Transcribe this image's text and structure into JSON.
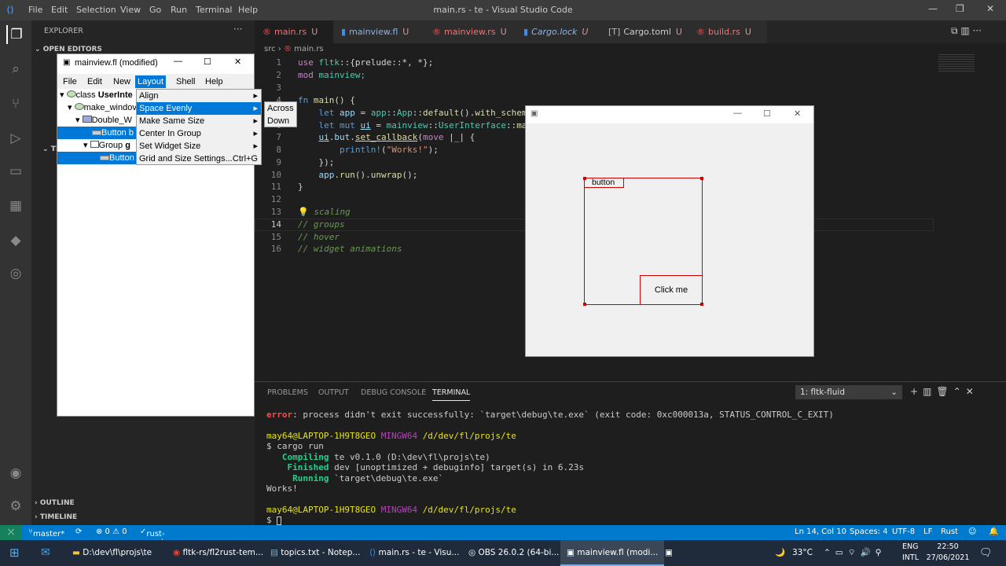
{
  "vscode": {
    "menu": [
      "File",
      "Edit",
      "Selection",
      "View",
      "Go",
      "Run",
      "Terminal",
      "Help"
    ],
    "title": "main.rs - te - Visual Studio Code"
  },
  "sidebar": {
    "explorer": "EXPLORER",
    "open_editors": "OPEN EDITORS",
    "te": "TE",
    "outline": "OUTLINE",
    "timeline": "TIMELINE"
  },
  "tabs": [
    {
      "label": "main.rs",
      "status": "U"
    },
    {
      "label": "mainview.fl",
      "status": "U"
    },
    {
      "label": "mainview.rs",
      "status": "U"
    },
    {
      "label": "Cargo.lock",
      "status": "U"
    },
    {
      "label": "Cargo.toml",
      "status": "U"
    },
    {
      "label": "build.rs",
      "status": "U"
    }
  ],
  "breadcrumb": {
    "folder": "src",
    "file": "main.rs"
  },
  "code": {
    "lines": [
      "1",
      "2",
      "3",
      "4",
      "5",
      "6",
      "7",
      "8",
      "9",
      "10",
      "11",
      "12",
      "13",
      "14",
      "15",
      "16"
    ],
    "l1a": "use ",
    "l1b": "fltk",
    "l1c": "::{prelude::*, *};",
    "l2a": "mod ",
    "l2b": "mainview;",
    "l4a": "fn ",
    "l4b": "main",
    "l4c": "() {",
    "l5a": "    let ",
    "l5b": "app",
    "l5c": " = ",
    "l5d": "app",
    "l5e": "::",
    "l5f": "App",
    "l5g": "::",
    "l5h": "default",
    "l5i": "().",
    "l5j": "with_scheme",
    "l6a": "    let mut ",
    "l6b": "ui",
    "l6c": " = ",
    "l6d": "mainview",
    "l6e": "::",
    "l6f": "UserInterface",
    "l6g": "::",
    "l6h": "make",
    "l7a": "    ",
    "l7b": "ui",
    "l7c": ".",
    "l7d": "but",
    "l7e": ".",
    "l7f": "set_callback",
    "l7g": "(",
    "l7h": "move",
    "l7i": " |_| {",
    "l8a": "        ",
    "l8b": "println!",
    "l8c": "(",
    "l8d": "\"Works!\"",
    "l8e": ");",
    "l9": "    });",
    "l10a": "    ",
    "l10b": "app",
    "l10c": ".",
    "l10d": "run",
    "l10e": "().",
    "l10f": "unwrap",
    "l10g": "();",
    "l11": "}",
    "l13": "scaling",
    "l14": "// groups",
    "l15": "// hover",
    "l16": "// widget animations"
  },
  "panel": {
    "tabs": [
      "PROBLEMS",
      "OUTPUT",
      "DEBUG CONSOLE",
      "TERMINAL"
    ],
    "terminal_select": "1: fltk-fluid",
    "lines": {
      "err_a": "error",
      "err_b": ": process didn't exit successfully: `target\\debug\\te.exe` (exit code: 0xc000013a, STATUS_CONTROL_C_EXIT)",
      "p1_user": "may64@LAPTOP-1H9T8GEO",
      "p1_env": "MINGW64",
      "p1_path": "/d/dev/fl/projs/te",
      "cmd": "$ cargo run",
      "c1a": "   Compiling",
      "c1b": " te v0.1.0 (D:\\dev\\fl\\projs\\te)",
      "c2a": "    Finished",
      "c2b": " dev [unoptimized + debuginfo] target(s) in 6.23s",
      "c3a": "     Running",
      "c3b": " `target\\debug\\te.exe`",
      "works": "Works!",
      "p2_user": "may64@LAPTOP-1H9T8GEO",
      "p2_env": "MINGW64",
      "p2_path": "/d/dev/fl/projs/te",
      "prompt": "$ "
    }
  },
  "status": {
    "branch": "master*",
    "errors": "⊗ 0 ⚠ 0",
    "rust": "rust-analyzer",
    "pos": "Ln 14, Col 10",
    "spaces": "Spaces: 4",
    "enc": "UTF-8",
    "eol": "LF",
    "lang": "Rust"
  },
  "fluid": {
    "title": "mainview.fl (modified)",
    "menu": [
      "File",
      "Edit",
      "New",
      "Layout",
      "Shell",
      "Help"
    ],
    "tree": [
      {
        "label": "class",
        "bold": "UserInte"
      },
      {
        "label": "make_windov"
      },
      {
        "label": "Double_W"
      },
      {
        "label": "Button",
        "extra": "b"
      },
      {
        "label": "Group",
        "extra": "g"
      },
      {
        "label": "Button"
      }
    ]
  },
  "layout_menu": {
    "items": [
      "Align",
      "Space Evenly",
      "Make Same Size",
      "Center In Group",
      "Set Widget Size",
      "Grid and Size Settings..."
    ],
    "shortcut": "Ctrl+G",
    "submenu": [
      "Across",
      "Down"
    ]
  },
  "app_window": {
    "button_label": "button",
    "click_label": "Click me"
  },
  "taskbar": {
    "items": [
      "D:\\dev\\fl\\projs\\te",
      "fltk-rs/fl2rust-tem...",
      "topics.txt - Notep...",
      "main.rs - te - Visu...",
      "OBS 26.0.2 (64-bi...",
      "mainview.fl (modi..."
    ],
    "temp": "33°C",
    "lang1": "ENG",
    "lang2": "INTL",
    "time": "22:50",
    "date": "27/06/2021"
  },
  "colors": {
    "accent": "#007acc",
    "error": "#f14c4c",
    "rust_tab": "#e37b7b",
    "selection": "#0078d7"
  }
}
